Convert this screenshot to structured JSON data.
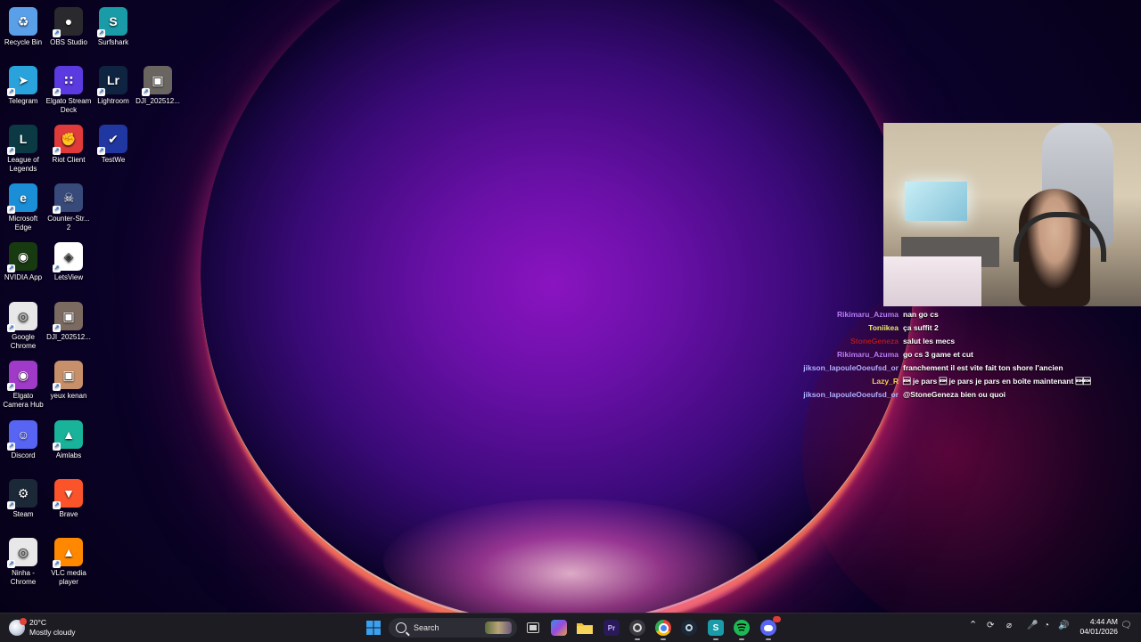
{
  "desktop": {
    "icons": [
      {
        "label": "Recycle Bin",
        "icon": "recycle-bin-icon",
        "color": "#5aa0e8"
      },
      {
        "label": "OBS Studio",
        "icon": "obs-icon",
        "color": "#2a2a2e"
      },
      {
        "label": "Surfshark",
        "icon": "surfshark-icon",
        "color": "#1a9ba8"
      },
      {
        "label": "Telegram",
        "icon": "telegram-icon",
        "color": "#2aa3dd"
      },
      {
        "label": "Elgato Stream Deck",
        "icon": "stream-deck-icon",
        "color": "#5b3be0"
      },
      {
        "label": "Lightroom",
        "icon": "lightroom-icon",
        "color": "#0f2440"
      },
      {
        "label": "DJI_202512...",
        "icon": "video-file-icon",
        "color": "#6a6560"
      },
      {
        "label": "League of Legends",
        "icon": "league-icon",
        "color": "#0b3a44"
      },
      {
        "label": "Riot Client",
        "icon": "riot-icon",
        "color": "#e03a3a"
      },
      {
        "label": "TestWe",
        "icon": "testwe-icon",
        "color": "#2036a0"
      },
      {
        "label": "Microsoft Edge",
        "icon": "edge-icon",
        "color": "#1a8fd8"
      },
      {
        "label": "Counter-Str... 2",
        "icon": "cs2-icon",
        "color": "#384a7a"
      },
      {
        "label": "NVIDIA App",
        "icon": "nvidia-icon",
        "color": "#183a10"
      },
      {
        "label": "LetsView",
        "icon": "letsview-icon",
        "color": "#ffffff"
      },
      {
        "label": "Google Chrome",
        "icon": "chrome-icon",
        "color": "#e8e8e8"
      },
      {
        "label": "DJI_202512...",
        "icon": "image-file-icon",
        "color": "#7a6a60"
      },
      {
        "label": "Elgato Camera Hub",
        "icon": "camera-hub-icon",
        "color": "#a03ac8"
      },
      {
        "label": "yeux kenan",
        "icon": "image-file-icon",
        "color": "#c8906a"
      },
      {
        "label": "Discord",
        "icon": "discord-icon",
        "color": "#5865f2"
      },
      {
        "label": "Aimlabs",
        "icon": "aimlabs-icon",
        "color": "#19b39a"
      },
      {
        "label": "Steam",
        "icon": "steam-icon",
        "color": "#1b2838"
      },
      {
        "label": "Brave",
        "icon": "brave-icon",
        "color": "#fb542b"
      },
      {
        "label": "Ninha - Chrome",
        "icon": "chrome-profile-icon",
        "color": "#e8e8e8"
      },
      {
        "label": "VLC media player",
        "icon": "vlc-icon",
        "color": "#ff8800"
      }
    ]
  },
  "chat": {
    "messages": [
      {
        "user": "Rikimaru_Azuma",
        "color": "#b77cf2",
        "text": "nan go cs"
      },
      {
        "user": "Toniikea",
        "color": "#e8e86a",
        "text": "ça suffit 2"
      },
      {
        "user": "StoneGeneza",
        "color": "#b01818",
        "text": "salut les mecs"
      },
      {
        "user": "Rikimaru_Azuma",
        "color": "#b77cf2",
        "text": "go cs 3 game et cut"
      },
      {
        "user": "jikson_lapouleOoeufsd_or",
        "color": "#b0b0ff",
        "text": "franchement il est vite fait ton shore l'ancien"
      },
      {
        "user": "Lazy_R",
        "color": "#f0d24a",
        "text": "\u0001 je pars \u0001 je pars je pars en boîte maintenant \u0001\u0001"
      },
      {
        "user": "jikson_lapouleOoeufsd_or",
        "color": "#b0b0ff",
        "text": "@StoneGeneza bien ou quoi"
      }
    ]
  },
  "taskbar": {
    "weather_temp": "20°C",
    "weather_desc": "Mostly cloudy",
    "search_label": "Search",
    "time": "4:44 AM",
    "date": "04/01/2026",
    "apps": [
      {
        "name": "start-button",
        "icon": "windows-icon",
        "color": "#3aa0f0"
      },
      {
        "name": "task-view",
        "icon": "task-view-icon",
        "color": "#d0d0d0"
      },
      {
        "name": "taskbar-copilot",
        "icon": "copilot-icon",
        "color": "#5aa0e8"
      },
      {
        "name": "taskbar-explorer",
        "icon": "folder-icon",
        "color": "#f2c233"
      },
      {
        "name": "taskbar-premiere",
        "icon": "premiere-icon",
        "color": "#2a1a5a"
      },
      {
        "name": "taskbar-obs",
        "icon": "obs-icon",
        "color": "#3a3a40"
      },
      {
        "name": "taskbar-chrome",
        "icon": "chrome-icon",
        "color": "#e8e8e8"
      },
      {
        "name": "taskbar-steam",
        "icon": "steam-icon",
        "color": "#1b2838"
      },
      {
        "name": "taskbar-surfshark",
        "icon": "surfshark-icon",
        "color": "#1a9ba8"
      },
      {
        "name": "taskbar-spotify",
        "icon": "spotify-icon",
        "color": "#1db954"
      },
      {
        "name": "taskbar-discord",
        "icon": "discord-icon",
        "color": "#5865f2"
      }
    ]
  }
}
